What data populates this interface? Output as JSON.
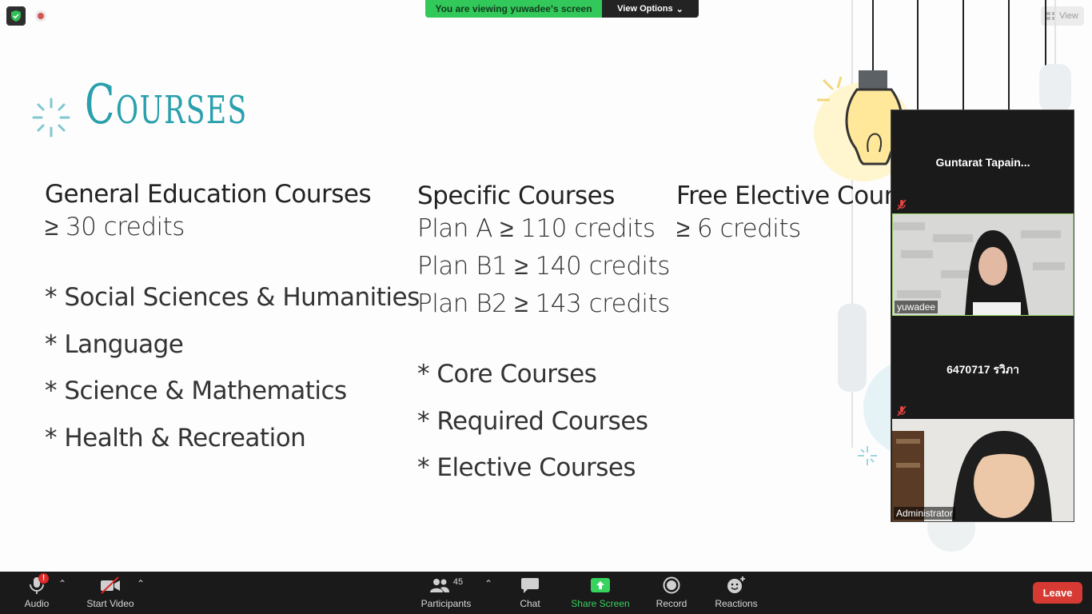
{
  "topbar": {
    "viewing_text": "You are viewing yuwadee's screen",
    "view_options_label": "View Options",
    "view_button_label": "View"
  },
  "slide": {
    "title": "Courses",
    "general": {
      "heading": "General Education Courses",
      "credits": "≥ 30 credits",
      "bullets": [
        "* Social Sciences & Humanities",
        "*  Language",
        "*  Science & Mathematics",
        "*  Health &  Recreation"
      ]
    },
    "specific": {
      "heading": "Specific Courses",
      "plans": [
        "Plan A ≥ 110 credits",
        "Plan B1 ≥ 140 credits",
        "Plan B2 ≥ 143 credits"
      ],
      "bullets": [
        "*  Core Courses",
        "*  Required Courses",
        "*  Elective Courses"
      ]
    },
    "free": {
      "heading": "Free Elective Courses",
      "credits": "≥ 6 credits"
    }
  },
  "participants_panel": {
    "tiles": [
      {
        "name": "Guntarat  Tapain...",
        "muted": true,
        "video": false
      },
      {
        "name": "yuwadee",
        "muted": false,
        "video": true
      },
      {
        "name": "6470717 รวิภา",
        "muted": true,
        "video": false
      },
      {
        "name": "Administrator",
        "muted": false,
        "video": true
      }
    ]
  },
  "toolbar": {
    "audio_label": "Audio",
    "audio_alert": "!",
    "video_label": "Start Video",
    "participants_label": "Participants",
    "participants_count": "45",
    "chat_label": "Chat",
    "share_label": "Share Screen",
    "record_label": "Record",
    "reactions_label": "Reactions",
    "leave_label": "Leave"
  },
  "colors": {
    "title_teal": "#2aa0ad",
    "share_green": "#38d25f",
    "banner_green": "#32c95a",
    "leave_red": "#d63a32"
  }
}
